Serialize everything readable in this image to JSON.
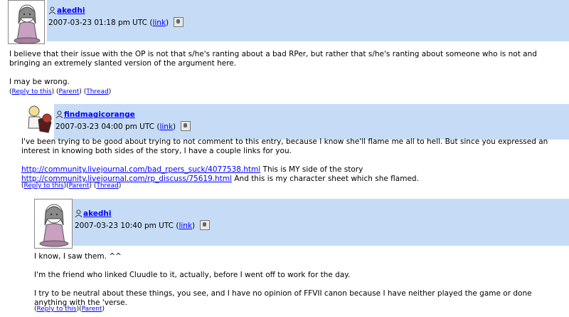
{
  "comments": [
    {
      "username": "akedhi",
      "timestamp": "2007-03-23 01:18 pm UTC",
      "link_label": "link",
      "body": [
        "I believe that their issue with the OP is not that s/he's ranting about a bad RPer, but rather that s/he's ranting about someone who is not and bringing an extremely slanted version of the argument here.",
        "I may be wrong."
      ],
      "actions": [
        "Reply to this",
        "Parent",
        "Thread"
      ]
    },
    {
      "username": "findmagicorange",
      "timestamp": "2007-03-23 04:00 pm UTC",
      "link_label": "link",
      "body_intro": "I've been trying to be good about trying to not comment to this entry, because I know she'll flame me all to hell. But since you expressed an interest in knowing both sides of the story, I have a couple links for you.",
      "links": [
        {
          "url": "http://community.livejournal.com/bad_rpers_suck/4077538.html",
          "text": " This is MY side of the story"
        },
        {
          "url": "http://community.livejournal.com/rp_discuss/75619.html",
          "text": " And this is my character sheet which she flamed."
        }
      ],
      "actions": [
        "Reply to this",
        "Parent",
        "Thread"
      ]
    },
    {
      "username": "akedhi",
      "timestamp": "2007-03-23 10:40 pm UTC",
      "link_label": "link",
      "body": [
        "I know, I saw them. ^^",
        "I'm the friend who linked Cluudle to it, actually, before I went off to work for the day.",
        "I try to be neutral about these things, you see, and I have no opinion of FFVII canon because I have neither played the game or done anything with the 'verse."
      ],
      "actions": [
        "Reply to this",
        "Parent"
      ]
    }
  ]
}
